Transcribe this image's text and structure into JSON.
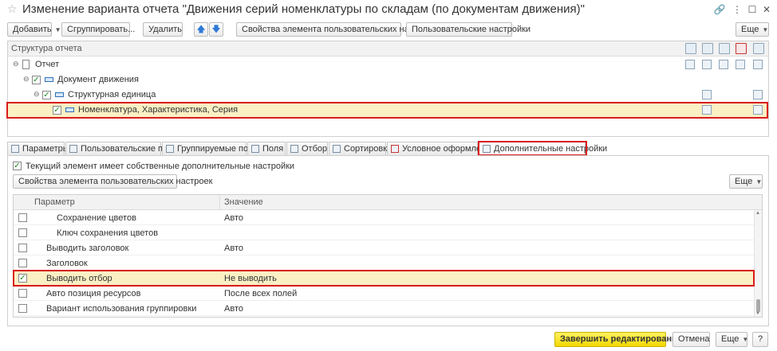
{
  "window": {
    "title": "Изменение варианта отчета \"Движения серий номенклатуры по складам (по документам движения)\""
  },
  "toolbar": {
    "add": "Добавить",
    "group": "Сгруппировать...",
    "delete": "Удалить",
    "up": "🡅",
    "down": "🡇",
    "element_props": "Свойства элемента пользовательских настроек",
    "user_settings": "Пользовательские настройки",
    "more": "Еще"
  },
  "structure": {
    "header": "Структура отчета",
    "rows": [
      {
        "label": "Отчет"
      },
      {
        "label": "Документ движения",
        "checked": true
      },
      {
        "label": "Структурная единица",
        "checked": true
      },
      {
        "label": "Номенклатура, Характеристика, Серия",
        "checked": true,
        "selected": true
      }
    ]
  },
  "tabs": [
    {
      "label": "Параметры"
    },
    {
      "label": "Пользовательские поля"
    },
    {
      "label": "Группируемые поля"
    },
    {
      "label": "Поля"
    },
    {
      "label": "Отбор"
    },
    {
      "label": "Сортировка"
    },
    {
      "label": "Условное оформление"
    },
    {
      "label": "Дополнительные настройки",
      "active": true
    }
  ],
  "settings": {
    "own_settings_label": "Текущий элемент имеет собственные дополнительные настройки",
    "own_settings_checked": true,
    "element_props": "Свойства элемента пользовательских настроек",
    "more": "Еще",
    "columns": {
      "param": "Параметр",
      "value": "Значение"
    },
    "rows": [
      {
        "param": "Сохранение цветов",
        "value": "Авто",
        "indent": true
      },
      {
        "param": "Ключ сохранения цветов",
        "value": "",
        "indent": true
      },
      {
        "param": "Выводить заголовок",
        "value": "Авто"
      },
      {
        "param": "Заголовок",
        "value": ""
      },
      {
        "param": "Выводить отбор",
        "value": "Не выводить",
        "checked": true,
        "selected": true
      },
      {
        "param": "Авто позиция ресурсов",
        "value": "После всех полей"
      },
      {
        "param": "Вариант использования группировки",
        "value": "Авто"
      }
    ]
  },
  "footer": {
    "finish": "Завершить редактирование",
    "cancel": "Отмена",
    "more": "Еще",
    "help": "?"
  },
  "colors": {
    "highlight_frame": "#d91c1c",
    "selected_row": "#fbefc4",
    "primary_button": "#f2d805"
  }
}
